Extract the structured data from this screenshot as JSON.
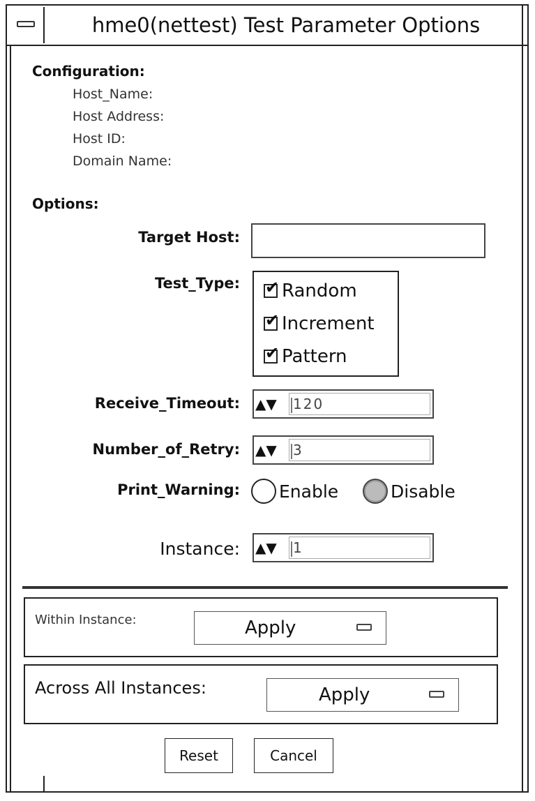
{
  "window": {
    "title": "hme0(nettest) Test Parameter Options",
    "menu_icon": "window-menu-icon"
  },
  "configuration": {
    "heading": "Configuration:",
    "fields": [
      {
        "label": "Host_Name:",
        "value": ""
      },
      {
        "label": "Host Address:",
        "value": ""
      },
      {
        "label": "Host ID:",
        "value": ""
      },
      {
        "label": "Domain Name:",
        "value": ""
      }
    ]
  },
  "options": {
    "heading": "Options:",
    "target_host": {
      "label": "Target Host:",
      "value": ""
    },
    "test_type": {
      "label": "Test_Type:",
      "items": [
        {
          "label": "Random",
          "checked": true
        },
        {
          "label": "Increment",
          "checked": true
        },
        {
          "label": "Pattern",
          "checked": true
        }
      ]
    },
    "receive_timeout": {
      "label": "Receive_Timeout:",
      "value": "120"
    },
    "number_of_retry": {
      "label": "Number_of_Retry:",
      "value": "3"
    },
    "print_warning": {
      "label": "Print_Warning:",
      "options": [
        "Enable",
        "Disable"
      ],
      "selected": "Disable"
    },
    "instance": {
      "label": "Instance:",
      "value": "1"
    }
  },
  "within_instance": {
    "label": "Within Instance:",
    "button": "Apply"
  },
  "across_instances": {
    "label": "Across All Instances:",
    "button": "Apply"
  },
  "buttons": {
    "reset": "Reset",
    "cancel": "Cancel"
  },
  "icons": {
    "checkmark": "✔",
    "spin_up": "▲",
    "spin_down": "▼"
  }
}
